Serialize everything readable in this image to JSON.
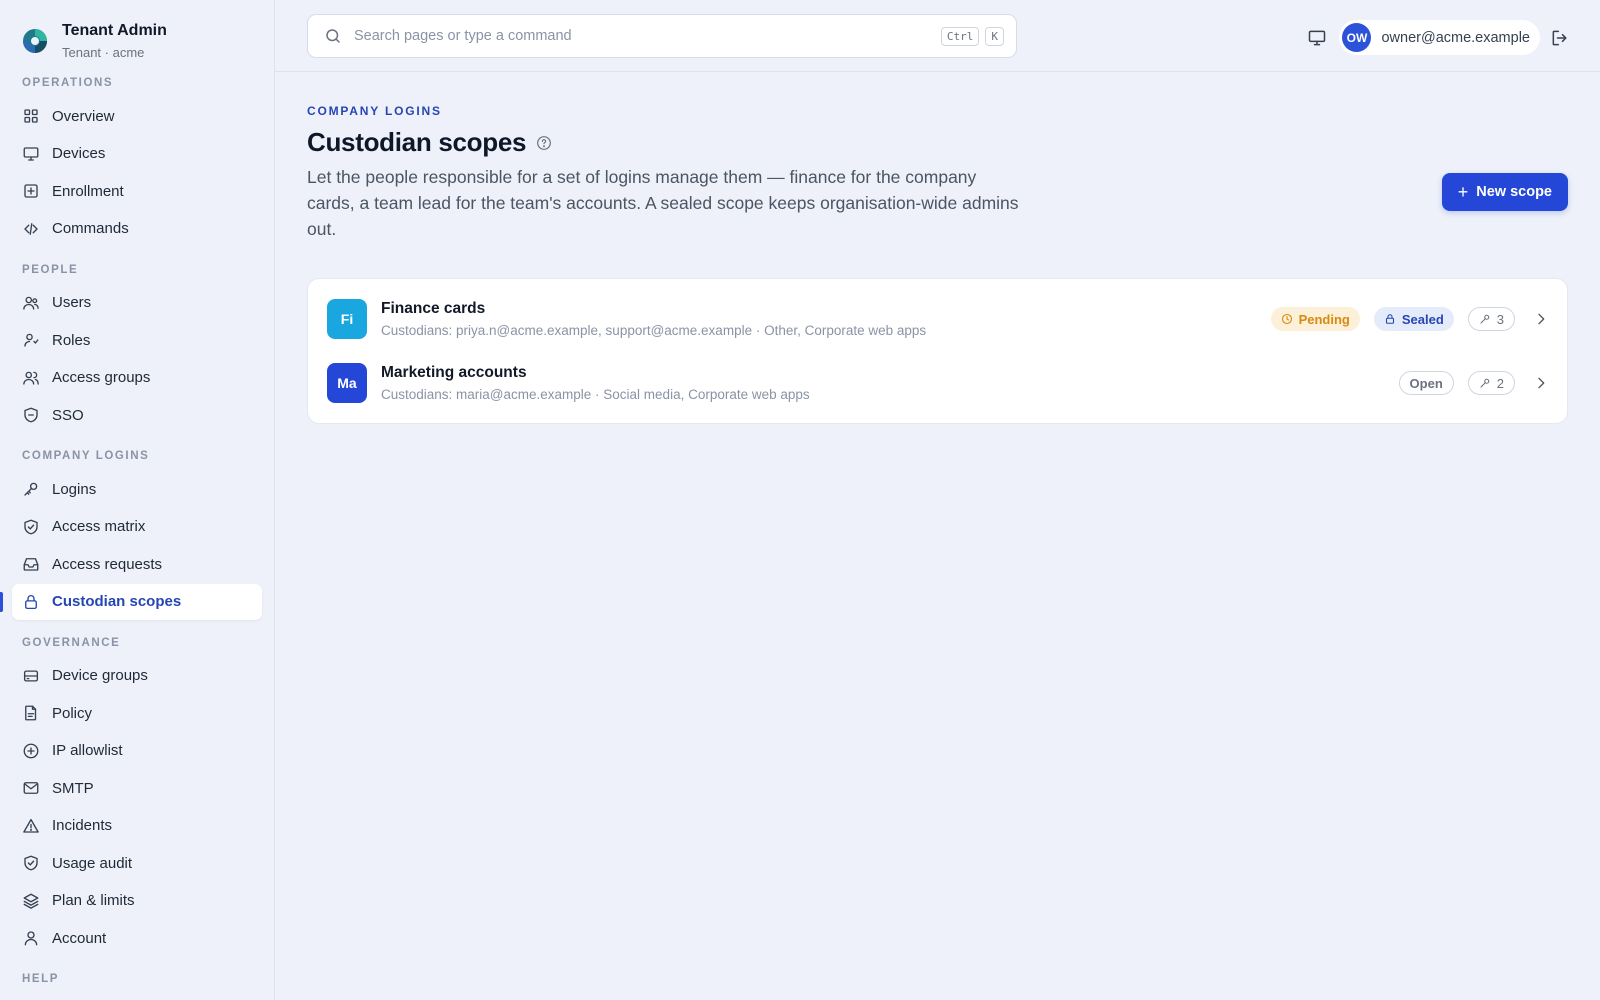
{
  "brand": {
    "title": "Tenant Admin",
    "subtitle": "Tenant · acme"
  },
  "sidebar": {
    "sections": [
      {
        "label": "OPERATIONS",
        "items": [
          {
            "label": "Overview",
            "icon": "grid-icon"
          },
          {
            "label": "Devices",
            "icon": "monitor-icon"
          },
          {
            "label": "Enrollment",
            "icon": "plus-square-icon"
          },
          {
            "label": "Commands",
            "icon": "code-icon"
          }
        ]
      },
      {
        "label": "PEOPLE",
        "items": [
          {
            "label": "Users",
            "icon": "users-icon"
          },
          {
            "label": "Roles",
            "icon": "user-role-icon"
          },
          {
            "label": "Access groups",
            "icon": "group-icon"
          },
          {
            "label": "SSO",
            "icon": "shield-minus-icon"
          }
        ]
      },
      {
        "label": "COMPANY LOGINS",
        "items": [
          {
            "label": "Logins",
            "icon": "key-icon"
          },
          {
            "label": "Access matrix",
            "icon": "shield-check-icon"
          },
          {
            "label": "Access requests",
            "icon": "inbox-icon"
          },
          {
            "label": "Custodian scopes",
            "icon": "lock-icon",
            "active": true
          }
        ]
      },
      {
        "label": "GOVERNANCE",
        "items": [
          {
            "label": "Device groups",
            "icon": "server-icon"
          },
          {
            "label": "Policy",
            "icon": "file-icon"
          },
          {
            "label": "IP allowlist",
            "icon": "plus-circle-icon"
          },
          {
            "label": "SMTP",
            "icon": "mail-icon"
          },
          {
            "label": "Incidents",
            "icon": "alert-triangle-icon"
          },
          {
            "label": "Usage audit",
            "icon": "shield-check-icon"
          },
          {
            "label": "Plan & limits",
            "icon": "layers-icon"
          },
          {
            "label": "Account",
            "icon": "user-icon"
          }
        ]
      },
      {
        "label": "HELP",
        "items": []
      }
    ]
  },
  "topbar": {
    "search_placeholder": "Search pages or type a command",
    "shortcut_ctrl": "Ctrl",
    "shortcut_key": "K",
    "user_initials": "OW",
    "user_email": "owner@acme.example"
  },
  "page": {
    "eyebrow": "COMPANY LOGINS",
    "title": "Custodian scopes",
    "description": "Let the people responsible for a set of logins manage them — finance for the company cards, a team lead for the team's accounts. A sealed scope keeps organisation-wide admins out.",
    "new_button": "New scope"
  },
  "scopes": [
    {
      "initials": "Fi",
      "color": "#1aa7e0",
      "name": "Finance cards",
      "details": "Custodians: priya.n@acme.example, support@acme.example · Other, Corporate web apps",
      "pending": "Pending",
      "sealed": "Sealed",
      "open": null,
      "count": "3"
    },
    {
      "initials": "Ma",
      "color": "#2447d8",
      "name": "Marketing accounts",
      "details": "Custodians: maria@acme.example · Social media, Corporate web apps",
      "pending": null,
      "sealed": null,
      "open": "Open",
      "count": "2"
    }
  ]
}
